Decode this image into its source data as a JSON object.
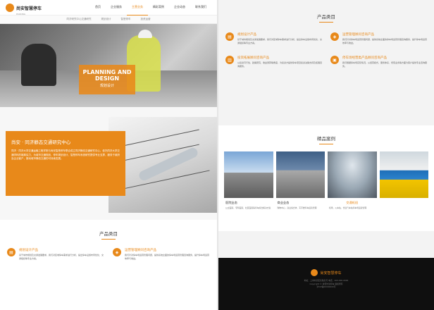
{
  "header": {
    "logo_text": "尚安智慧停车",
    "logo_sub": "PARKING",
    "nav": [
      "首页",
      "企业服务",
      "主营业务",
      "精彩案例",
      "企业动态",
      "联系我们"
    ]
  },
  "subnav": [
    "同济研究中心交通研究",
    "规划设计",
    "智慧停车",
    "投资运营"
  ],
  "hero": {
    "en": "PLANNING AND DESIGN",
    "cn": "规划设计"
  },
  "intro": {
    "title": "尚安 · 同济静态交通研究中心",
    "body": "同济 · 同济大学交通运输工程学院与尚安智慧停车联合成立同济静态交通研究中心，依托同济大学交通学科的雄厚实力，为城市交通规划、停车规划设计、智慧停车系统研究提供专业支撑，服务于政府及企业客户，推动城市静态交通的可持续发展。"
  },
  "products": {
    "title": "产品类目",
    "items": [
      {
        "name": "规划设计产品",
        "desc": "基于城市规划及交通发展要求，我们对区域停车需求进行分析，提出停车设施布局优化、交通组织等专业方案。"
      },
      {
        "name": "运营管理顾问咨询产品",
        "desc": "我们针对停车场运营管理问题，提供系统全面的停车场运营管理咨询服务，提升停车场运营效率与收益。"
      },
      {
        "name": "投资拓展顾问咨询产品",
        "desc": "从投资可行性、政策研究、收益测算等角度，为投资方提供停车项目投资决策支持及拓展咨询服务。"
      },
      {
        "name": "停车场经营类产品顾问咨询产品",
        "desc": "我们根据停车场实际情况，从经营模式、服务体系、增值业务等方面为客户提供专业咨询服务。"
      }
    ]
  },
  "cases": {
    "title": "精品案例",
    "items": [
      {
        "name": "医院业态",
        "desc": "公立医院、专科医院、社区医院等停车综合解决方案"
      },
      {
        "name": "商业业态",
        "desc": "购物中心、商业综合体、写字楼停车运营管理"
      },
      {
        "name": "交通枢纽",
        "desc": "机场、火车站、长途汽车站停车场运营管理"
      },
      {
        "name": "",
        "desc": ""
      }
    ]
  },
  "footer": {
    "logo": "尚安智慧停车",
    "lines": [
      "地址：上海市某区某路某号 电话：400-000-0000",
      "Copyright © 尚安智慧停车 版权所有",
      "沪ICP备00000000号"
    ]
  },
  "colors": {
    "accent": "#e8891a"
  }
}
